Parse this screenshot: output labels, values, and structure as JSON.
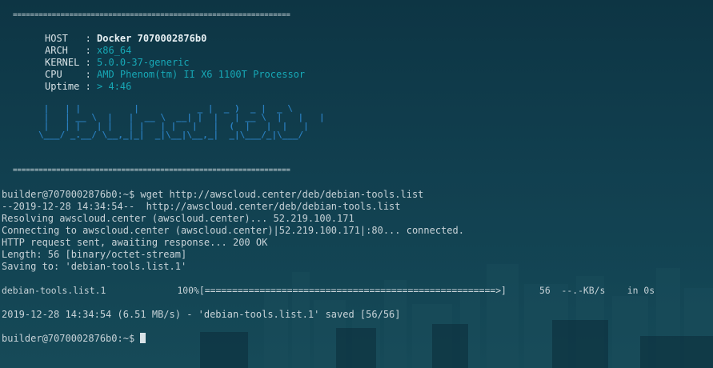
{
  "banner": {
    "rule": "================================================================",
    "host_label": "HOST   :",
    "host_value": "Docker 7070002876b0",
    "arch_label": "ARCH   :",
    "arch_value": "x86_64",
    "kernel_label": "KERNEL :",
    "kernel_value": "5.0.0-37-generic",
    "cpu_label": "CPU    :",
    "cpu_value": "AMD Phenom(tm) II X6 1100T Processor",
    "uptime_label": "Uptime :",
    "uptime_value": "> 4:46",
    "ascii_art": " |   | |          |           _ |  _ )  _ |  _ \\\n |   | __ \\  |   |  __ \\  __| |  |   | __ \\  |   |   |\n |   | |   | |   | |   | |   |   |  (  |   |  |   |\n\\___/ _.__/ \\__,_|_|  _|\\__|\\__,_|  _|\\___/_|\\___/"
  },
  "terminal": {
    "lines": [
      "builder@7070002876b0:~$ wget http://awscloud.center/deb/debian-tools.list",
      "--2019-12-28 14:34:54--  http://awscloud.center/deb/debian-tools.list",
      "Resolving awscloud.center (awscloud.center)... 52.219.100.171",
      "Connecting to awscloud.center (awscloud.center)|52.219.100.171|:80... connected.",
      "HTTP request sent, awaiting response... 200 OK",
      "Length: 56 [binary/octet-stream]",
      "Saving to: 'debian-tools.list.1'",
      "debian-tools.list.1             100%[=====================================================>]      56  --.-KB/s    in 0s",
      "2019-12-28 14:34:54 (6.51 MB/s) - 'debian-tools.list.1' saved [56/56]",
      "builder@7070002876b0:~$ "
    ]
  },
  "colors": {
    "background": "#0f3847",
    "text": "#c8d3d8",
    "accent_teal": "#17a8b6",
    "ascii_blue": "#2a7fc0"
  }
}
